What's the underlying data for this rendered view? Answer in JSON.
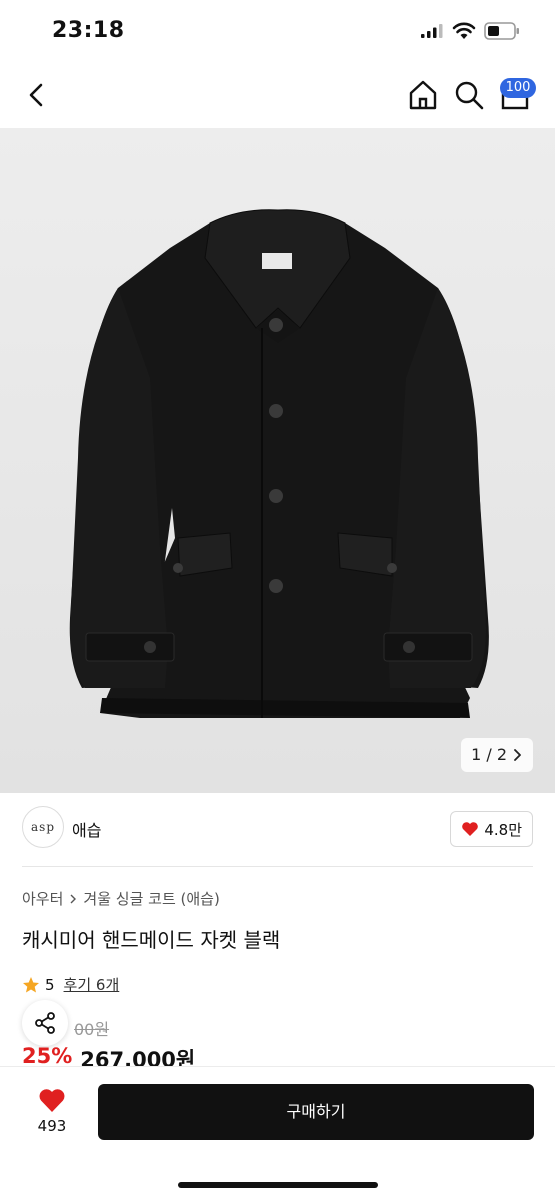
{
  "status_bar": {
    "time": "23:18"
  },
  "nav": {
    "cart_badge": "100",
    "icons": [
      "back-arrow-icon",
      "home-icon",
      "search-icon",
      "cart-icon"
    ]
  },
  "gallery": {
    "pager": "1 / 2"
  },
  "shop": {
    "logo_text": "asp",
    "name": "애습",
    "rating": "4.8만"
  },
  "product": {
    "breadcrumb": [
      "아우터",
      "겨울 싱글 코트 (애습)"
    ],
    "title": "캐시미어 핸드메이드 자켓 블랙",
    "rating": "5",
    "reviews_link": "후기 6개",
    "original_price_fragment": "00원",
    "discount": "25%",
    "price": "267,000원"
  },
  "bottom_bar": {
    "like_count": "493",
    "buy_label": "구매하기"
  },
  "colors": {
    "accent_red": "#e02020",
    "badge_blue": "#2f66e0",
    "button_black": "#111111",
    "star": "#f5a623"
  }
}
